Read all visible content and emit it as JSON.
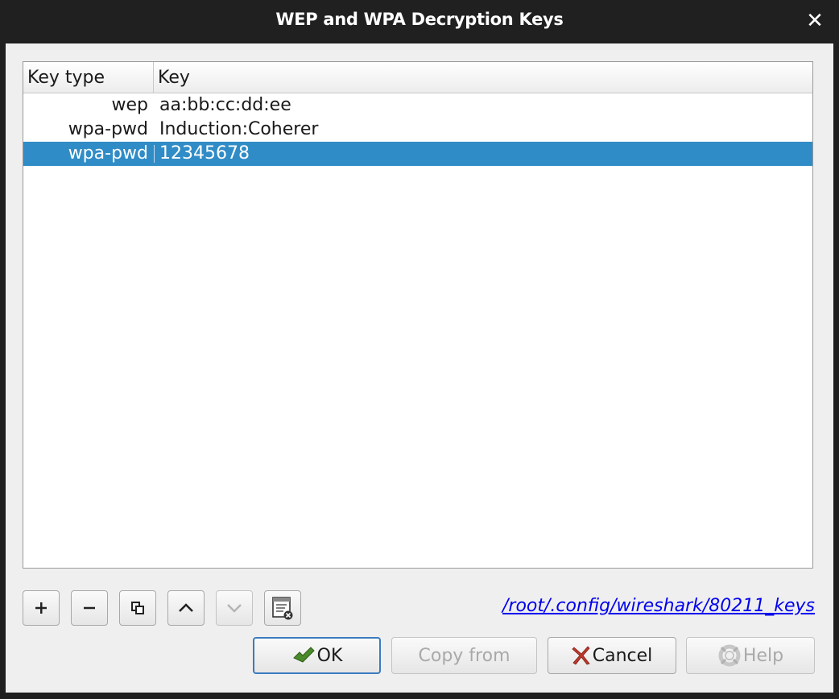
{
  "window": {
    "title": "WEP and WPA Decryption Keys",
    "close_glyph": "✕"
  },
  "table": {
    "columns": [
      "Key type",
      "Key"
    ],
    "rows": [
      {
        "type": "wep",
        "key": "aa:bb:cc:dd:ee",
        "selected": false
      },
      {
        "type": "wpa-pwd",
        "key": "Induction:Coherer",
        "selected": false
      },
      {
        "type": "wpa-pwd",
        "key": "12345678",
        "selected": true
      }
    ],
    "selection_color": "#308cc6"
  },
  "toolbar": {
    "buttons": [
      {
        "name": "add-entry-button",
        "icon": "plus-icon",
        "enabled": true
      },
      {
        "name": "remove-entry-button",
        "icon": "minus-icon",
        "enabled": true
      },
      {
        "name": "copy-entry-button",
        "icon": "copy-icon",
        "enabled": true
      },
      {
        "name": "move-up-button",
        "icon": "chevron-up-icon",
        "enabled": true
      },
      {
        "name": "move-down-button",
        "icon": "chevron-down-icon",
        "enabled": false
      },
      {
        "name": "clear-all-button",
        "icon": "clear-list-icon",
        "enabled": true
      }
    ],
    "file_path": "/root/.config/wireshark/80211_keys"
  },
  "buttons": {
    "ok": {
      "label": "OK",
      "icon": "ok-check-icon"
    },
    "copy_from": {
      "label": "Copy from",
      "enabled": false
    },
    "cancel": {
      "label": "Cancel",
      "icon": "cancel-x-icon"
    },
    "help": {
      "label": "Help",
      "icon": "help-lifebuoy-icon",
      "enabled": false
    }
  }
}
